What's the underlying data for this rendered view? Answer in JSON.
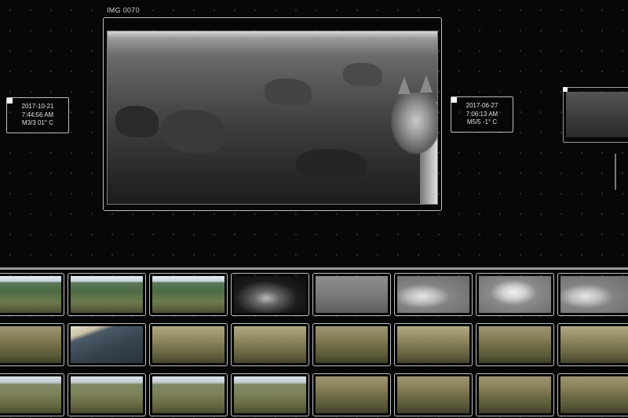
{
  "main_viewer": {
    "title": "IMG 0070"
  },
  "info_left": {
    "date": "2017-10-21",
    "time": "7:44:56 AM",
    "meta": "M3/3 01° C"
  },
  "info_right": {
    "date": "2017-06-27",
    "time": "7:06:13 AM",
    "meta": "M5/5 -1° C"
  },
  "colors": {
    "background": "#070707",
    "frame_border": "#bdbdbd",
    "marker": "#f2f2f2"
  },
  "thumbnail_grid": {
    "rows": [
      [
        "hill-day",
        "hill-day",
        "hill-day",
        "night",
        "ir",
        "ir-cat",
        "ir-cat2",
        "ir-cat"
      ],
      [
        "scrub",
        "slope",
        "scrub2",
        "scrub2",
        "scrub",
        "scrub2",
        "scrub",
        "scrub2"
      ],
      [
        "sky-hill",
        "sky-hill",
        "sky-hill",
        "sky-hill",
        "scrub",
        "scrub",
        "scrub",
        "scrub"
      ]
    ]
  }
}
